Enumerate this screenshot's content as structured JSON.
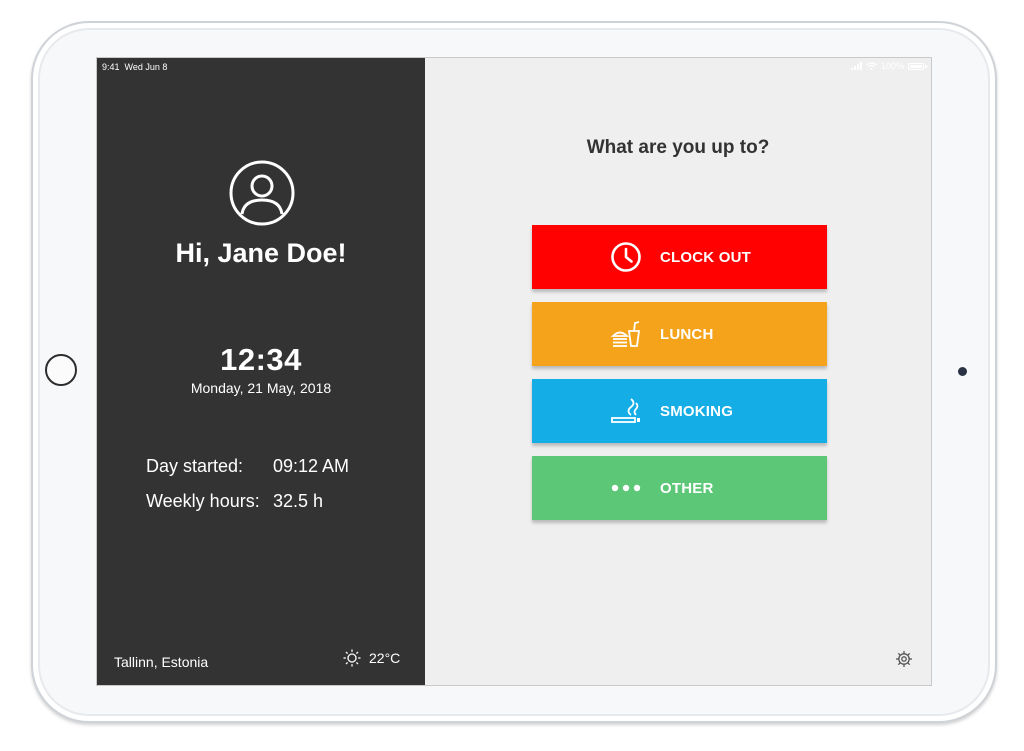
{
  "status_bar": {
    "time": "9:41",
    "date": "Wed Jun 8",
    "battery": "100%"
  },
  "profile": {
    "greeting": "Hi, Jane Doe!",
    "icon": "user-circle-icon"
  },
  "clock": {
    "time": "12:34",
    "date": "Monday, 21 May, 2018"
  },
  "stats": {
    "day_started_label": "Day started:",
    "day_started_value": "09:12 AM",
    "weekly_hours_label": "Weekly hours:",
    "weekly_hours_value": "32.5 h"
  },
  "weather": {
    "location": "Tallinn, Estonia",
    "temperature": "22°C",
    "icon": "sun-icon"
  },
  "main": {
    "question": "What are you up to?"
  },
  "actions": [
    {
      "label": "CLOCK OUT",
      "icon": "clock-icon",
      "color": "#fe0100"
    },
    {
      "label": "LUNCH",
      "icon": "lunch-icon",
      "color": "#f6a31c"
    },
    {
      "label": "SMOKING",
      "icon": "smoking-icon",
      "color": "#14ade6"
    },
    {
      "label": "OTHER",
      "icon": "more-dots-icon",
      "color": "#5cc776"
    }
  ],
  "settings": {
    "icon": "gear-icon"
  },
  "colors": {
    "sidebar_bg": "#333333",
    "main_bg": "#efefef"
  }
}
